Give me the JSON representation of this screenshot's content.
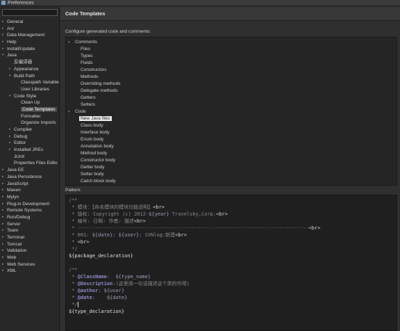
{
  "window": {
    "title": "Preferences"
  },
  "sidebar": {
    "filter_placeholder": "",
    "items": [
      {
        "label": "General",
        "indent": 0,
        "expandable": true
      },
      {
        "label": "Ant",
        "indent": 0,
        "expandable": true
      },
      {
        "label": "Data Management",
        "indent": 0,
        "expandable": true
      },
      {
        "label": "Help",
        "indent": 0,
        "expandable": true
      },
      {
        "label": "Install/Update",
        "indent": 0,
        "expandable": true
      },
      {
        "label": "Java",
        "indent": 0,
        "expandable": true,
        "expanded": true
      },
      {
        "label": "反编译器",
        "indent": 1,
        "expandable": false
      },
      {
        "label": "Appearance",
        "indent": 1,
        "expandable": true
      },
      {
        "label": "Build Path",
        "indent": 1,
        "expandable": true,
        "expanded": true
      },
      {
        "label": "Classpath Variable",
        "indent": 2,
        "expandable": false
      },
      {
        "label": "User Libraries",
        "indent": 2,
        "expandable": false
      },
      {
        "label": "Code Style",
        "indent": 1,
        "expandable": true,
        "expanded": true
      },
      {
        "label": "Clean Up",
        "indent": 2,
        "expandable": false
      },
      {
        "label": "Code Templates",
        "indent": 2,
        "expandable": false,
        "selected": true
      },
      {
        "label": "Formatter",
        "indent": 2,
        "expandable": false
      },
      {
        "label": "Organize Imports",
        "indent": 2,
        "expandable": false
      },
      {
        "label": "Compiler",
        "indent": 1,
        "expandable": true
      },
      {
        "label": "Debug",
        "indent": 1,
        "expandable": true
      },
      {
        "label": "Editor",
        "indent": 1,
        "expandable": true
      },
      {
        "label": "Installed JREs",
        "indent": 1,
        "expandable": true
      },
      {
        "label": "JUnit",
        "indent": 1,
        "expandable": false
      },
      {
        "label": "Properties Files Edito",
        "indent": 1,
        "expandable": false
      },
      {
        "label": "Java EE",
        "indent": 0,
        "expandable": true
      },
      {
        "label": "Java Persistence",
        "indent": 0,
        "expandable": true
      },
      {
        "label": "JavaScript",
        "indent": 0,
        "expandable": true
      },
      {
        "label": "Maven",
        "indent": 0,
        "expandable": true
      },
      {
        "label": "Mylyn",
        "indent": 0,
        "expandable": true
      },
      {
        "label": "Plug-in Development",
        "indent": 0,
        "expandable": true
      },
      {
        "label": "Remote Systems",
        "indent": 0,
        "expandable": true
      },
      {
        "label": "Run/Debug",
        "indent": 0,
        "expandable": true
      },
      {
        "label": "Server",
        "indent": 0,
        "expandable": true
      },
      {
        "label": "Team",
        "indent": 0,
        "expandable": true
      },
      {
        "label": "Terminal",
        "indent": 0,
        "expandable": true
      },
      {
        "label": "Tomcat",
        "indent": 0,
        "expandable": true
      },
      {
        "label": "Validation",
        "indent": 0,
        "expandable": true
      },
      {
        "label": "Web",
        "indent": 0,
        "expandable": true
      },
      {
        "label": "Web Services",
        "indent": 0,
        "expandable": true
      },
      {
        "label": "XML",
        "indent": 0,
        "expandable": true
      }
    ]
  },
  "page": {
    "title": "Code Templates",
    "description": "Configure generated code and comments:",
    "pattern_label": "Pattern:"
  },
  "templates": [
    {
      "label": "Comments",
      "kind": "group"
    },
    {
      "label": "Files",
      "kind": "child"
    },
    {
      "label": "Types",
      "kind": "child"
    },
    {
      "label": "Fields",
      "kind": "child"
    },
    {
      "label": "Constructors",
      "kind": "child"
    },
    {
      "label": "Methods",
      "kind": "child"
    },
    {
      "label": "Overriding methods",
      "kind": "child"
    },
    {
      "label": "Delegate methods",
      "kind": "child"
    },
    {
      "label": "Getters",
      "kind": "child"
    },
    {
      "label": "Setters",
      "kind": "child"
    },
    {
      "label": "Code",
      "kind": "group"
    },
    {
      "label": "New Java files",
      "kind": "child",
      "selected": true
    },
    {
      "label": "Class body",
      "kind": "child"
    },
    {
      "label": "Interface body",
      "kind": "child"
    },
    {
      "label": "Enum body",
      "kind": "child"
    },
    {
      "label": "Annotation body",
      "kind": "child"
    },
    {
      "label": "Method body",
      "kind": "child"
    },
    {
      "label": "Constructor body",
      "kind": "child"
    },
    {
      "label": "Getter body",
      "kind": "child"
    },
    {
      "label": "Setter body",
      "kind": "child"
    },
    {
      "label": "Catch block body",
      "kind": "child"
    }
  ],
  "pattern": [
    [
      [
        "c-comment",
        "/**"
      ]
    ],
    [
      [
        "c-comment",
        " * 模块：【命名模块的模块功能说明】"
      ],
      [
        "c-tag",
        "<br>"
      ]
    ],
    [
      [
        "c-comment",
        " * 版权: Copyright (c) 2012-"
      ],
      [
        "c-var",
        "${year}"
      ],
      [
        "c-comment",
        " Travelsky,Corp."
      ],
      [
        "c-tag",
        "<br>"
      ]
    ],
    [
      [
        "c-comment",
        " * 编号: 日期: 作者: 描述"
      ],
      [
        "c-tag",
        "<br>"
      ]
    ],
    [
      [
        "c-comment",
        " * -------------------------------------------------------------------------------"
      ],
      [
        "c-tag",
        "<br>"
      ]
    ],
    [
      [
        "c-comment",
        " * 001: "
      ],
      [
        "c-var",
        "${date}"
      ],
      [
        "c-comment",
        ": "
      ],
      [
        "c-var",
        "${user}"
      ],
      [
        "c-comment",
        ": SVNlog:新建"
      ],
      [
        "c-tag",
        "<br>"
      ]
    ],
    [
      [
        "c-comment",
        " * "
      ],
      [
        "c-tag",
        "<br>"
      ]
    ],
    [
      [
        "c-comment",
        " */"
      ]
    ],
    [
      [
        "c-plain",
        "${package_declaration}"
      ]
    ],
    [
      [
        "c-plain",
        ""
      ]
    ],
    [
      [
        "c-comment",
        "/**"
      ]
    ],
    [
      [
        "c-comment",
        " * "
      ],
      [
        "c-kw",
        "@ClassName"
      ],
      [
        "c-comment",
        ":  "
      ],
      [
        "c-var",
        "${type_name}"
      ]
    ],
    [
      [
        "c-comment",
        " * "
      ],
      [
        "c-kw",
        "@Description"
      ],
      [
        "c-comment",
        ":(这里用一句话描述这个类的作用)"
      ]
    ],
    [
      [
        "c-comment",
        " * "
      ],
      [
        "c-kw",
        "@author"
      ],
      [
        "c-comment",
        ": "
      ],
      [
        "c-var",
        "${user}"
      ]
    ],
    [
      [
        "c-comment",
        " * "
      ],
      [
        "c-kw",
        "@date"
      ],
      [
        "c-comment",
        ":    "
      ],
      [
        "c-var",
        "${date}"
      ]
    ],
    [
      [
        "c-comment",
        " */"
      ],
      [
        "caret",
        ""
      ]
    ],
    [
      [
        "c-plain",
        "${type_declaration}"
      ]
    ]
  ]
}
